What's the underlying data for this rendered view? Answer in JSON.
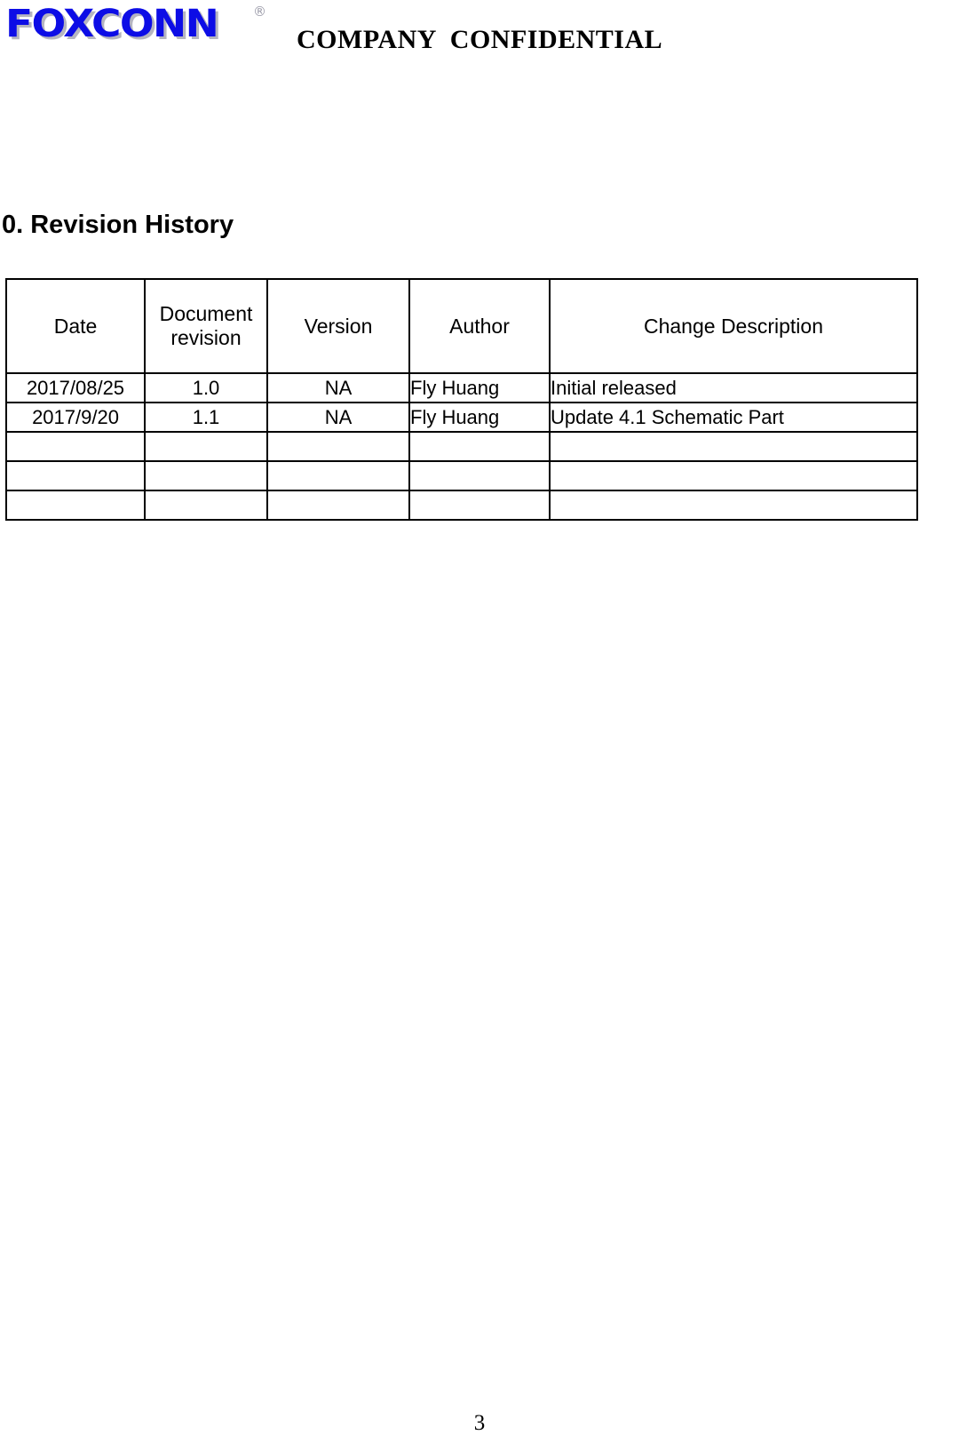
{
  "header": {
    "logo_text": "FOXCONN",
    "logo_registered_mark": "®",
    "logo_color": "#0d0de6",
    "confidential_label": "COMPANY  CONFIDENTIAL"
  },
  "section": {
    "title": "0. Revision History"
  },
  "table": {
    "columns": [
      "Date",
      "Document revision",
      "Version",
      "Author",
      "Change Description"
    ],
    "column_lines": {
      "date": "Date",
      "document_revision_line1": "Document",
      "document_revision_line2": "revision",
      "version": "Version",
      "author": "Author",
      "change_description": "Change Description"
    },
    "rows": [
      {
        "date": "2017/08/25",
        "document_revision": "1.0",
        "version": "NA",
        "author": "Fly Huang",
        "change_description": "Initial released"
      },
      {
        "date": "2017/9/20",
        "document_revision": "1.1",
        "version": "NA",
        "author": "Fly Huang",
        "change_description": "Update 4.1 Schematic Part"
      },
      {
        "date": "",
        "document_revision": "",
        "version": "",
        "author": "",
        "change_description": ""
      },
      {
        "date": "",
        "document_revision": "",
        "version": "",
        "author": "",
        "change_description": ""
      },
      {
        "date": "",
        "document_revision": "",
        "version": "",
        "author": "",
        "change_description": ""
      }
    ]
  },
  "footer": {
    "page_number": "3"
  }
}
